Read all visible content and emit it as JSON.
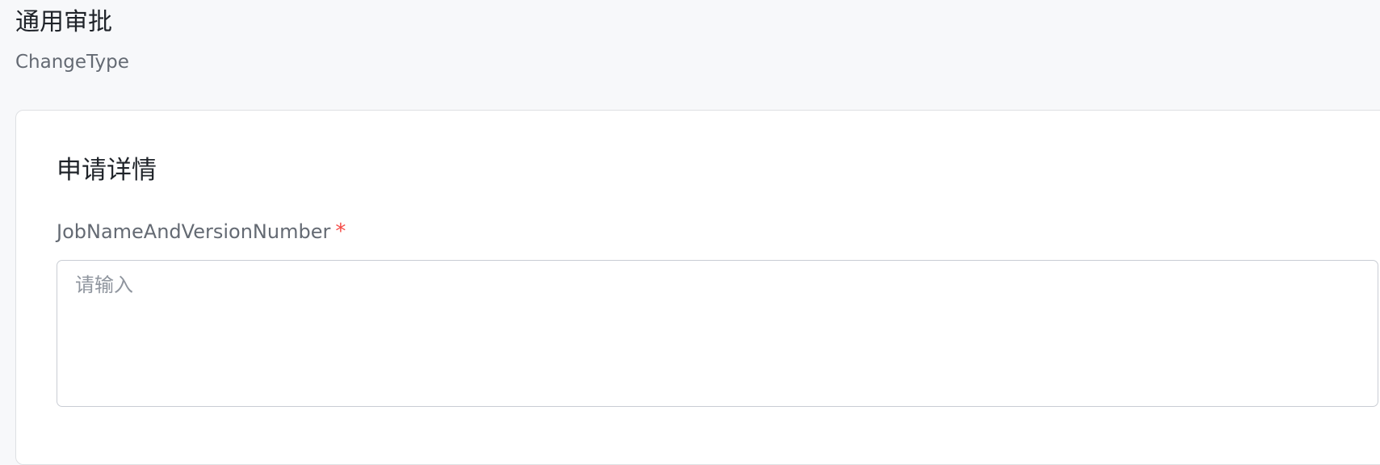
{
  "header": {
    "title": "通用审批",
    "subtitle": "ChangeType"
  },
  "form": {
    "section_title": "申请详情",
    "fields": [
      {
        "label": "JobNameAndVersionNumber",
        "required_mark": "*",
        "placeholder": "请输入",
        "value": ""
      }
    ]
  },
  "colors": {
    "page_background": "#f7f8fa",
    "card_background": "#ffffff",
    "required": "#f54a45",
    "border": "#c9cdd4"
  }
}
